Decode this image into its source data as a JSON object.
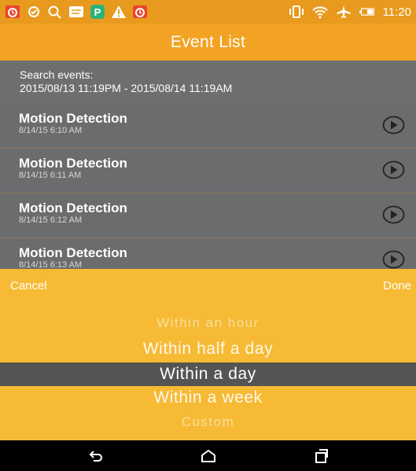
{
  "status_bar": {
    "time": "11:20",
    "icons": [
      "alarm-icon",
      "sync-icon",
      "search-icon",
      "message-icon",
      "p-app-icon",
      "warning-icon",
      "alarm-icon",
      "vibrate-icon",
      "wifi-icon",
      "airplane-icon",
      "battery-icon"
    ]
  },
  "header": {
    "title": "Event List"
  },
  "search": {
    "label": "Search events:",
    "range": "2015/08/13 11:19PM - 2015/08/14 11:19AM"
  },
  "events": [
    {
      "title": "Motion Detection",
      "time": "8/14/15 6:10 AM"
    },
    {
      "title": "Motion Detection",
      "time": "8/14/15 6:11 AM"
    },
    {
      "title": "Motion Detection",
      "time": "8/14/15 6:12 AM"
    },
    {
      "title": "Motion Detection",
      "time": "8/14/15 6:13 AM"
    }
  ],
  "picker": {
    "cancel_label": "Cancel",
    "done_label": "Done",
    "options": [
      "Within an hour",
      "Within half a day",
      "Within a day",
      "Within a week",
      "Custom"
    ],
    "selected": "Within a day"
  },
  "nav": {
    "icons": [
      "back-icon",
      "home-icon",
      "recents-icon"
    ]
  },
  "colors": {
    "accent": "#F2A324",
    "sheet": "#F6BA35",
    "selected_row": "#555452"
  }
}
